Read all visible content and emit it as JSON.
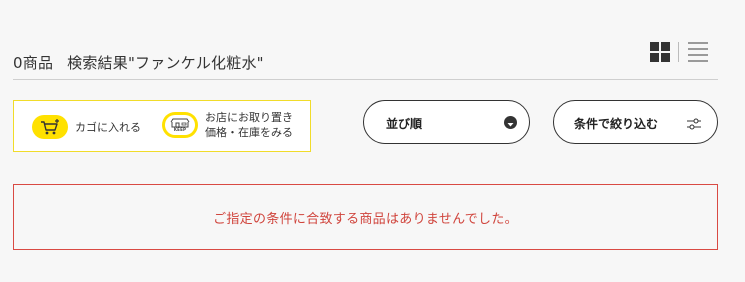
{
  "result": {
    "count_label": "0商品",
    "query_label": "検索結果\"ファンケル化粧水\""
  },
  "view_toggle": {
    "grid_icon": "grid-view-icon",
    "list_icon": "list-view-icon"
  },
  "legend": {
    "cart_label": "カゴに入れる",
    "keep_label_line1": "お店にお取り置き",
    "keep_label_line2": "価格・在庫をみる",
    "keep_badge": "KEEP"
  },
  "sort": {
    "label": "並び順",
    "icon": "chevron-down-circle-icon"
  },
  "filter": {
    "label": "条件で絞り込む",
    "icon": "sliders-icon"
  },
  "message": {
    "no_results": "ご指定の条件に合致する商品はありませんでした。"
  },
  "colors": {
    "accent_yellow": "#ffe100",
    "legend_border": "#f1dc2a",
    "error_red": "#d0443c",
    "text": "#333333"
  }
}
